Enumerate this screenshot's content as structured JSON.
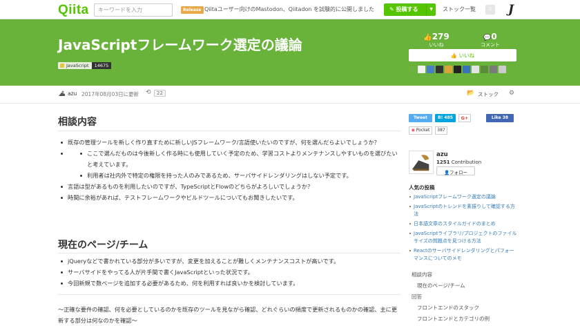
{
  "header": {
    "logo": "Qiita",
    "search_placeholder": "キーワードを入力",
    "release_badge": "Release",
    "news": "Qiitaユーザー向けのMastodon、Qiitadon を試験的に公開しました",
    "post_button": "投稿する",
    "stock_list": "ストック一覧",
    "notifications": "0"
  },
  "article": {
    "title": "JavaScriptフレームワーク選定の議論",
    "tag": {
      "name": "JavaScript",
      "count": "14675"
    },
    "likes_count": "279",
    "likes_label": "いいね",
    "comments_count": "0",
    "comments_label": "コメント",
    "iine_button": "いいね",
    "author": "azu",
    "date": "2017年08月03日に更新",
    "revisions": "22",
    "stock_label": "ストック"
  },
  "content": {
    "section1": {
      "heading": "相談内容",
      "items": [
        "既存の管理ツールを新しく作り直すために新しいJSフレームワーク/言語使いたいのですが、何を選んだらよいでしょうか？",
        "ここで選んだものは今後新しく作る時にも使用していく予定のため、学習コストよりメンテナンスしやすいものを選びたいと考えています。",
        "利用者は社内外で特定の権限を持った人のみであるため、サーバサイドレンダリングはしない予定です。",
        "言語は型があるものを利用したいのですが、TypeScriptとFlowのどちらがよろしいでしょうか？",
        "時間に余裕があれば、テストフレームワークやビルドツールについてもお聞きしたいです。"
      ]
    },
    "section2": {
      "heading": "現在のページ/チーム",
      "items": [
        "jQueryなどで書かれている部分が多いですが、変更を加えることが難しくメンテナンスコストが高いです。",
        "サーバサイドをやってる人が片手間で書くJavaScriptといった状況です。",
        "今回新規で数ページを追加する必要があるため、何を利用すれば良いかを検討しています。"
      ]
    },
    "paragraph": "〜正確な要件の確認、何を必要としているのかを既存のツールを見ながら確認、どれぐらいの頻度で更新されるものかの確認、主に更新する部分は何なのかを確認〜"
  },
  "sidebar": {
    "tweet": "Tweet",
    "hatena": "B! 485",
    "gplus": "G+",
    "facebook": "Like 38",
    "pocket": "Pocket",
    "pocket_count": "387",
    "author_name": "azu",
    "contribution_count": "1251",
    "contribution_label": "Contribution",
    "follow": "フォロー",
    "popular_heading": "人気の投稿",
    "popular": [
      "JavaScriptフレームワーク選定の議論",
      "JavaScriptのトレンドを素振りして確認する方法",
      "日本語文章のスタイルガイドのまとめ",
      "JavaScriptライブラリ/プロジェクトのファイルサイズの問題点を見つける方法",
      "Reactのサーバサイドレンダリングとパフォーマンスについてのメモ"
    ],
    "toc": [
      "相談内容",
      "現在のページ/チーム",
      "回答",
      "フロントエンドのスタック",
      "フロントエンドとカテゴリの例"
    ]
  },
  "colors": {
    "brand": "#55c500",
    "hero": "#69b33a",
    "link": "#337ab7"
  }
}
